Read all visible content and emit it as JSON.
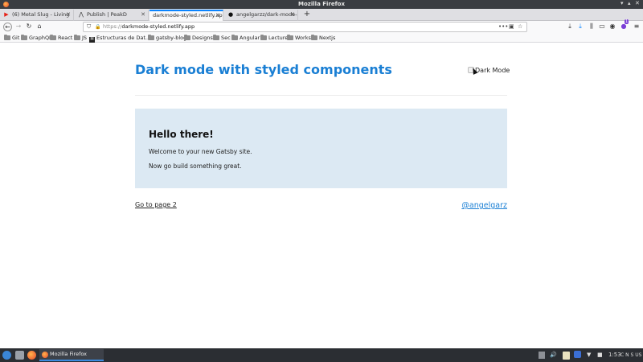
{
  "window": {
    "title": "Mozilla Firefox",
    "controls": {
      "minimize": "▾",
      "maximize": "▴",
      "close": "✕"
    }
  },
  "tabs": [
    {
      "label": "(6) Metal Slug - Living",
      "favicon": "youtube-icon",
      "active": false
    },
    {
      "label": "Publish | PeakD",
      "favicon": "peakd-icon",
      "active": false
    },
    {
      "label": "darkmode-styled.netlify.app",
      "favicon": "none",
      "active": true
    },
    {
      "label": "angelgarzz/dark-mode-s",
      "favicon": "github-icon",
      "active": false
    }
  ],
  "tab_close": "✕",
  "new_tab": "+",
  "nav": {
    "back": "←",
    "forward": "→",
    "reload": "↻",
    "home": "⌂",
    "url_protocol": "https://",
    "url_host": "darkmode-styled.netlify.app",
    "page_actions": "•••",
    "pocket": "▣",
    "star": "☆",
    "download": "⤓",
    "library": "⫼",
    "reader": "▭",
    "account": "◉",
    "extension_badge": "1",
    "menu": "≡"
  },
  "bookmarks": [
    {
      "label": "Git",
      "icon": "folder-icon"
    },
    {
      "label": "GraphQL",
      "icon": "folder-icon"
    },
    {
      "label": "React",
      "icon": "folder-icon"
    },
    {
      "label": "JS",
      "icon": "folder-icon"
    },
    {
      "label": "Estructuras de Dat...",
      "icon": "medium-logo"
    },
    {
      "label": "gatsby-blog",
      "icon": "folder-icon"
    },
    {
      "label": "Designs",
      "icon": "folder-icon"
    },
    {
      "label": "Sec",
      "icon": "folder-icon"
    },
    {
      "label": "Angular",
      "icon": "folder-icon"
    },
    {
      "label": "Lecture",
      "icon": "folder-icon"
    },
    {
      "label": "Works",
      "icon": "folder-icon"
    },
    {
      "label": "Nextjs",
      "icon": "folder-icon"
    }
  ],
  "medium_letter": "M",
  "page": {
    "site_title": "Dark mode with styled components",
    "dark_mode_label": "Dark Mode",
    "dark_mode_checked": false,
    "hero_heading": "Hello there!",
    "hero_line1": "Welcome to your new Gatsby site.",
    "hero_line2": "Now go build something great.",
    "page2_link": "Go to page 2",
    "author_link": "@angelgarz",
    "accent_color": "#1a7fd4",
    "hero_bg_color": "#dce9f3"
  },
  "taskbar": {
    "task_label": "Mozilla Firefox",
    "clock": "1:53",
    "locale": "C N S US",
    "tray_icons": [
      "volume-icon",
      "notes-icon",
      "badge-icon",
      "wifi-icon",
      "camera-icon",
      "power-icon"
    ]
  }
}
